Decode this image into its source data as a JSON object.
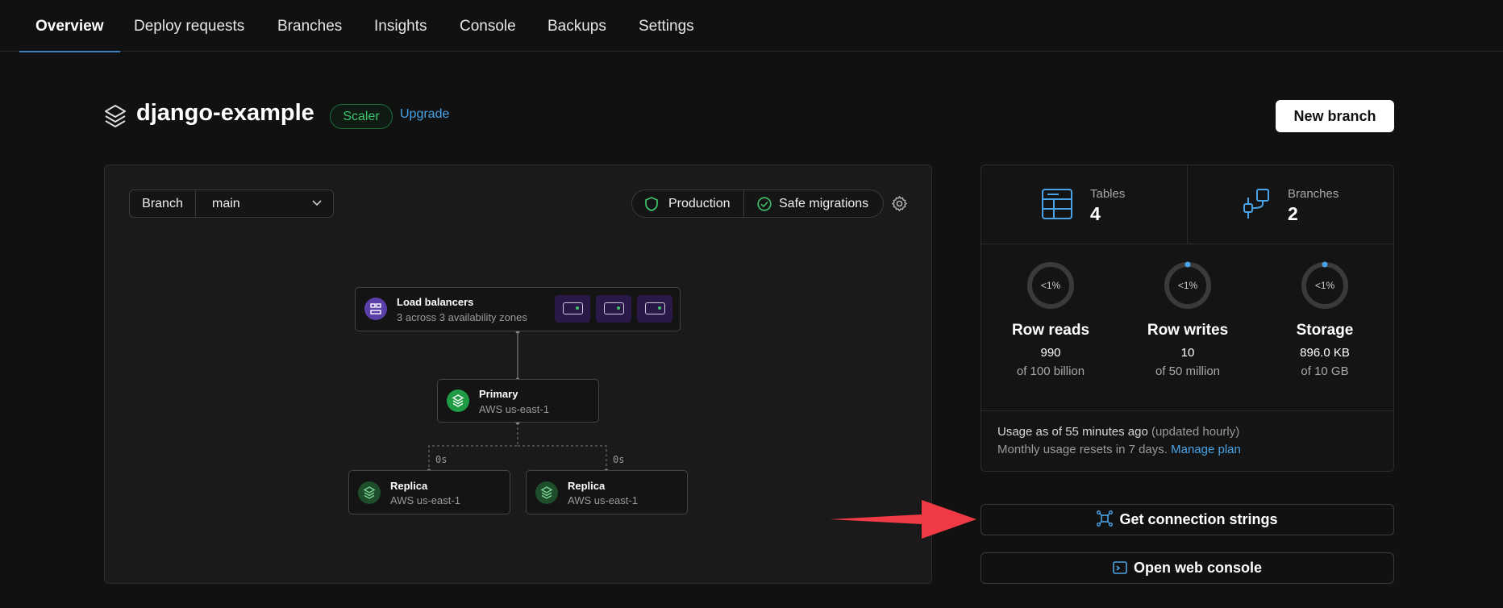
{
  "nav": {
    "tabs": [
      {
        "label": "Overview",
        "active": true
      },
      {
        "label": "Deploy requests"
      },
      {
        "label": "Branches"
      },
      {
        "label": "Insights"
      },
      {
        "label": "Console"
      },
      {
        "label": "Backups"
      },
      {
        "label": "Settings"
      }
    ]
  },
  "header": {
    "title": "django-example",
    "plan": "Scaler",
    "upgrade_label": "Upgrade",
    "new_branch_label": "New branch",
    "icon": "database-layers-icon"
  },
  "branch": {
    "label": "Branch",
    "value": "main"
  },
  "status": {
    "production": "Production",
    "safe_migrations": "Safe migrations"
  },
  "graph": {
    "load_balancer": {
      "title": "Load balancers",
      "subtitle": "3 across 3 availability zones"
    },
    "primary": {
      "title": "Primary",
      "subtitle": "AWS us-east-1"
    },
    "replicas": [
      {
        "title": "Replica",
        "subtitle": "AWS us-east-1",
        "lag": "0s"
      },
      {
        "title": "Replica",
        "subtitle": "AWS us-east-1",
        "lag": "0s"
      }
    ]
  },
  "stats": {
    "tables": {
      "label": "Tables",
      "value": "4"
    },
    "branches": {
      "label": "Branches",
      "value": "2"
    },
    "usage": [
      {
        "gauge": "<1%",
        "name": "Row reads",
        "value": "990",
        "of": "of 100 billion"
      },
      {
        "gauge": "<1%",
        "name": "Row writes",
        "value": "10",
        "of": "of 50 million"
      },
      {
        "gauge": "<1%",
        "name": "Storage",
        "value": "896.0 KB",
        "of": "of 10 GB"
      }
    ],
    "note": {
      "line1": "Usage as of 55 minutes ago",
      "line1_muted": "(updated hourly)",
      "line2": "Monthly usage resets in 7 days.",
      "manage_plan": "Manage plan"
    }
  },
  "actions": {
    "connection": "Get connection strings",
    "console": "Open web console"
  },
  "colors": {
    "accent": "#4aa3e6",
    "success": "#3ec46d",
    "arrow": "#f03a46"
  }
}
